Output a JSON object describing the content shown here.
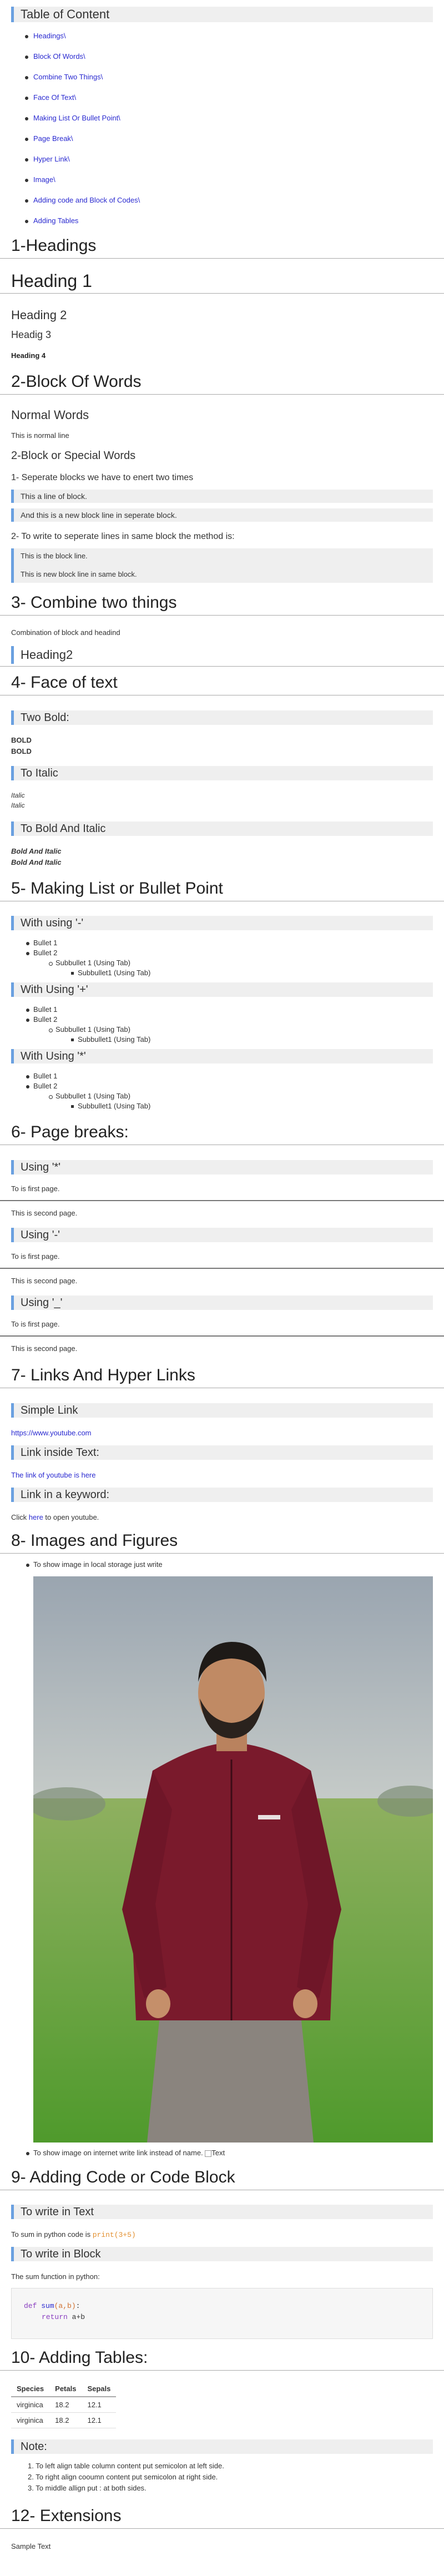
{
  "toc": {
    "title": "Table of Content",
    "items": [
      "Headings\\",
      "Block Of Words\\",
      "Combine Two Things\\",
      "Face Of Text\\",
      "Making List Or Bullet Point\\",
      "Page Break\\",
      "Hyper Link\\",
      "Image\\",
      "Adding code and Block of Codes\\",
      "Adding Tables"
    ]
  },
  "headings": {
    "title": "1-Headings",
    "h1": "Heading 1",
    "h2": "Heading 2",
    "h3": "Headig 3",
    "h4": "Heading 4"
  },
  "block_words": {
    "title": "2-Block Of Words",
    "normal_heading": "Normal Words",
    "normal_text": "This is normal line",
    "special_heading": "2-Block or Special Words",
    "step1": "1- Seperate blocks we have to enert two times",
    "block1": "This a line of block.",
    "block2": "And this is a new block line in seperate block.",
    "step2": "2- To write to seperate lines in same block the method is:",
    "block3a": "This is the block line.",
    "block3b": "This is new block line in same block."
  },
  "combine": {
    "title": "3- Combine two things",
    "text": "Combination of block and headind",
    "heading2": "Heading2"
  },
  "face": {
    "title": "4- Face of text",
    "two_bold": "Two Bold:",
    "bold": "BOLD",
    "italic_heading": "To Italic",
    "italic": "Italic",
    "bold_italic_heading": "To Bold And Italic",
    "bold_italic": "Bold And Italic"
  },
  "lists": {
    "title": "5- Making List or Bullet Point",
    "dash_heading": "With using '-'",
    "plus_heading": "With Using '+'",
    "star_heading": "With Using '*'",
    "bullet1": "Bullet 1",
    "bullet2": "Bullet 2",
    "sub1": "Subbullet 1 (Using Tab)",
    "sub2": "Subbullet1 (Using Tab)"
  },
  "breaks": {
    "title": "6- Page breaks:",
    "star": "Using '*'",
    "dash": "Using '-'",
    "underscore": "Using '_'",
    "first": "To is first page.",
    "second": "This is second page."
  },
  "links": {
    "title": "7- Links And Hyper Links",
    "simple": "Simple Link",
    "url": "https://www.youtube.com",
    "inside": "Link inside Text:",
    "inside_text": "The link of youtube is here",
    "keyword": "Link in a keyword:",
    "click": "Click ",
    "here": "here",
    "rest": " to open youtube."
  },
  "images": {
    "title": "8- Images and Figures",
    "local": "To show image in local storage just write",
    "internet": "To show image on internet write link instead of name.",
    "alt": "Text"
  },
  "code": {
    "title": "9- Adding Code or Code Block",
    "in_text": "To write in Text",
    "sum_text": "To sum in python code is ",
    "inline": "print(3+5)",
    "in_block": "To write in Block",
    "fn_text": "The sum function in python:",
    "line1_kw": "def",
    "line1_fn": "sum",
    "line1_args": "(a,b)",
    "line1_end": ":",
    "line2_kw": "return",
    "line2_expr": "a+b"
  },
  "tables": {
    "title": "10- Adding Tables:",
    "headers": [
      "Species",
      "Petals",
      "Sepals"
    ],
    "rows": [
      [
        "virginica",
        "18.2",
        "12.1"
      ],
      [
        "virginica",
        "18.2",
        "12.1"
      ]
    ],
    "note": "Note:",
    "notes": [
      "To left align table column content put semicolon at left side.",
      "To right align cooumn content put semicolon at right side.",
      "To middle allign put : at both sides."
    ]
  },
  "extensions": {
    "title": "12- Extensions",
    "text": "Sample Text"
  },
  "colors": {
    "accent": "#6aa0e0",
    "link": "#2a2ad0",
    "band": "#efefef"
  }
}
